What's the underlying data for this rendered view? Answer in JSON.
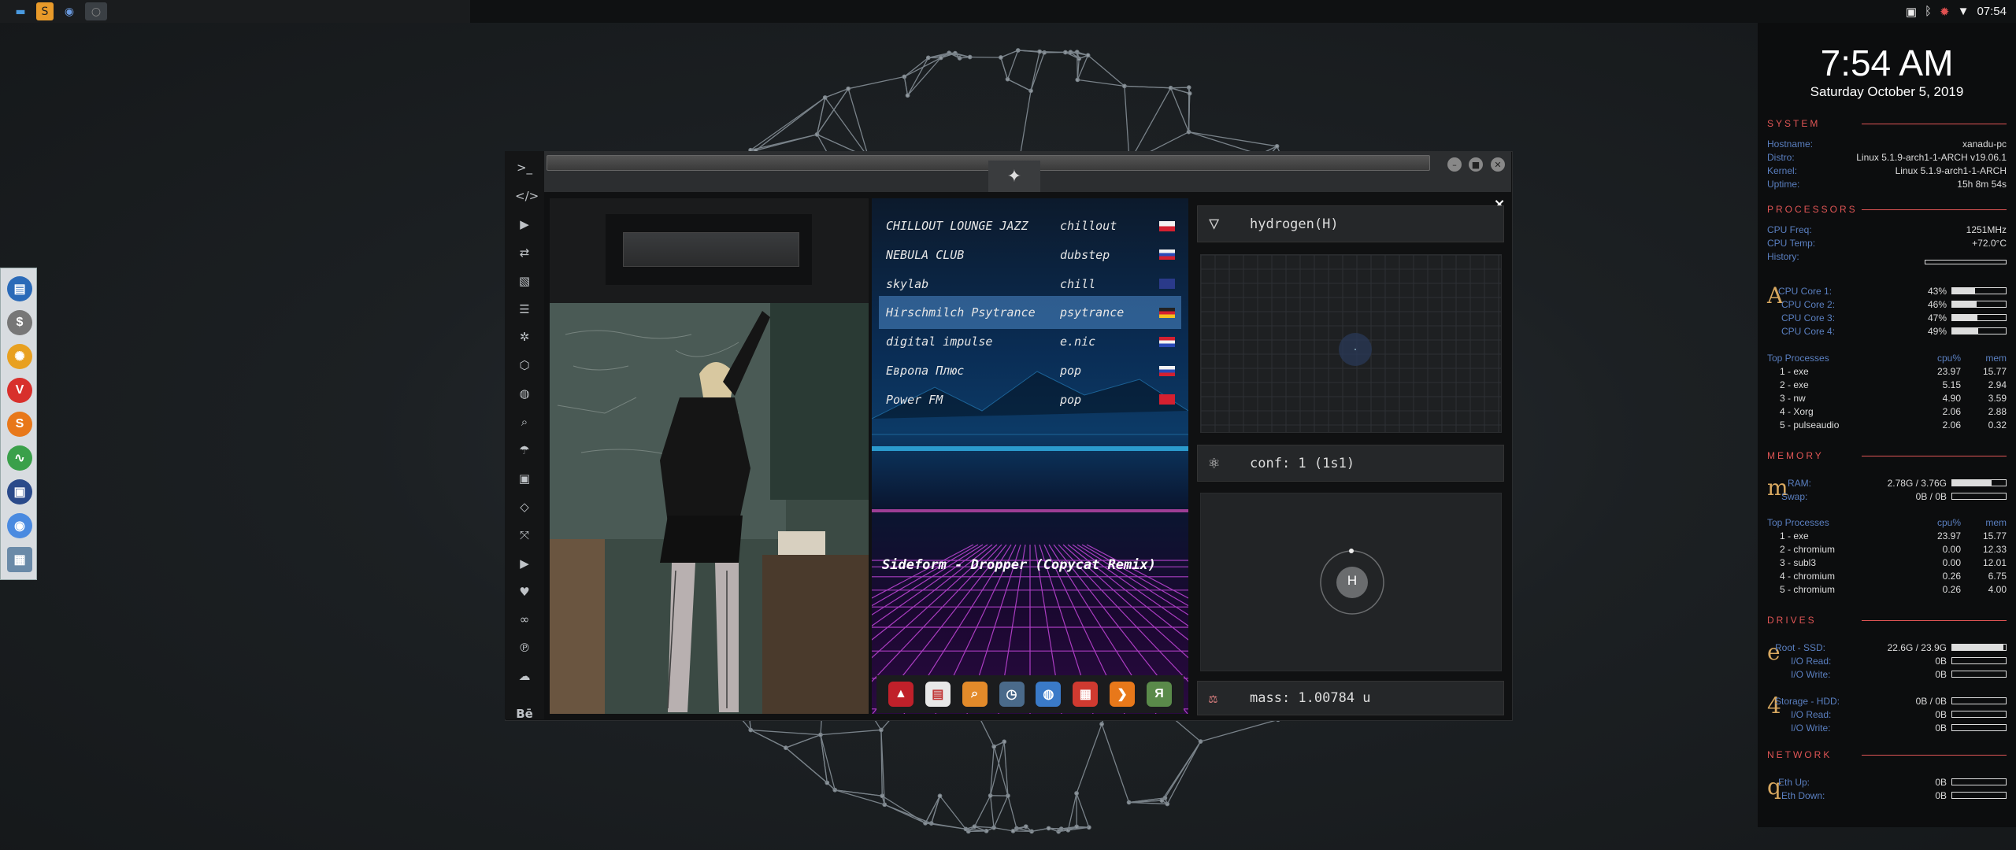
{
  "topbar": {
    "apps": [
      "files",
      "sublime",
      "chromium",
      "terminal"
    ],
    "time": "07:54"
  },
  "dock": {
    "items": [
      "files",
      "money",
      "settings",
      "vivaldi",
      "sublime",
      "activity",
      "screen",
      "chrome",
      "network"
    ]
  },
  "conky": {
    "clock": "7:54 AM",
    "date": "Saturday October  5, 2019",
    "system": {
      "title": "SYSTEM",
      "rows": [
        {
          "k": "Hostname:",
          "v": "xanadu-pc"
        },
        {
          "k": "Distro:",
          "v": "Linux 5.1.9-arch1-1-ARCH v19.06.1"
        },
        {
          "k": "Kernel:",
          "v": "Linux 5.1.9-arch1-1-ARCH"
        },
        {
          "k": "Uptime:",
          "v": "15h 8m 54s"
        }
      ]
    },
    "processors": {
      "title": "PROCESSORS",
      "rows": [
        {
          "k": "CPU Freq:",
          "v": "1251MHz"
        },
        {
          "k": "CPU Temp:",
          "v": "+72.0°C"
        },
        {
          "k": "History:",
          "v": ""
        }
      ],
      "letter": "A",
      "cores": [
        {
          "k": "CPU Core 1:",
          "v": "43%",
          "p": 43
        },
        {
          "k": "CPU Core 2:",
          "v": "46%",
          "p": 46
        },
        {
          "k": "CPU Core 3:",
          "v": "47%",
          "p": 47
        },
        {
          "k": "CPU Core 4:",
          "v": "49%",
          "p": 49
        }
      ],
      "top_title": "Top Processes",
      "col_cpu": "cpu%",
      "col_mem": "mem",
      "top": [
        {
          "name": "1 - exe",
          "cpu": "23.97",
          "mem": "15.77"
        },
        {
          "name": "2 - exe",
          "cpu": "5.15",
          "mem": "2.94"
        },
        {
          "name": "3 - nw",
          "cpu": "4.90",
          "mem": "3.59"
        },
        {
          "name": "4 - Xorg",
          "cpu": "2.06",
          "mem": "2.88"
        },
        {
          "name": "5 - pulseaudio",
          "cpu": "2.06",
          "mem": "0.32"
        }
      ]
    },
    "memory": {
      "title": "MEMORY",
      "letter": "m",
      "rows": [
        {
          "k": "RAM:",
          "v": "2.78G / 3.76G",
          "p": 74
        },
        {
          "k": "Swap:",
          "v": "0B / 0B",
          "p": 0
        }
      ],
      "top_title": "Top Processes",
      "col_cpu": "cpu%",
      "col_mem": "mem",
      "top": [
        {
          "name": "1 - exe",
          "cpu": "23.97",
          "mem": "15.77"
        },
        {
          "name": "2 - chromium",
          "cpu": "0.00",
          "mem": "12.33"
        },
        {
          "name": "3 - subl3",
          "cpu": "0.00",
          "mem": "12.01"
        },
        {
          "name": "4 - chromium",
          "cpu": "0.26",
          "mem": "6.75"
        },
        {
          "name": "5 - chromium",
          "cpu": "0.26",
          "mem": "4.00"
        }
      ]
    },
    "drives": {
      "title": "DRIVES",
      "root": {
        "letter": "e",
        "rows": [
          {
            "k": "Root  -  SSD:",
            "v": "22.6G / 23.9G",
            "p": 95
          },
          {
            "k": "I/O Read:",
            "v": "0B",
            "p": 0
          },
          {
            "k": "I/O Write:",
            "v": "0B",
            "p": 0
          }
        ]
      },
      "storage": {
        "letter": "4",
        "rows": [
          {
            "k": "Storage  -  HDD:",
            "v": "0B / 0B",
            "p": 0
          },
          {
            "k": "I/O Read:",
            "v": "0B",
            "p": 0
          },
          {
            "k": "I/O Write:",
            "v": "0B",
            "p": 0
          }
        ]
      }
    },
    "network": {
      "title": "NETWORK",
      "letter": "q",
      "rows": [
        {
          "k": "Eth Up:",
          "v": "0B",
          "p": 0
        },
        {
          "k": "Eth Down:",
          "v": "0B",
          "p": 0
        }
      ]
    }
  },
  "window": {
    "sidebar_icons": [
      "terminal-icon",
      "code-icon",
      "play-icon",
      "translate-icon",
      "image-icon",
      "news-icon",
      "settings-icon",
      "hexagon-icon",
      "globe-icon",
      "search-icon",
      "umbrella-icon",
      "contact-icon",
      "tag-icon",
      "expand-icon",
      "youtube-icon",
      "heart-icon",
      "infinity-icon",
      "pinterest-icon",
      "cloud-icon",
      "behance-icon"
    ],
    "behance_label": "Bē",
    "radio": {
      "stations": [
        {
          "name": "CHILLOUT LOUNGE JAZZ",
          "genre": "chillout",
          "flag": "pl"
        },
        {
          "name": "NEBULA CLUB",
          "genre": "dubstep",
          "flag": "ru"
        },
        {
          "name": "skylab",
          "genre": "chill",
          "flag": "gb"
        },
        {
          "name": "Hirschmilch Psytrance",
          "genre": "psytrance",
          "flag": "de",
          "selected": true
        },
        {
          "name": "digital impulse",
          "genre": "e.nic",
          "flag": "hr"
        },
        {
          "name": "Европа Плюс",
          "genre": "pop",
          "flag": "ru"
        },
        {
          "name": "Power FM",
          "genre": "pop",
          "flag": "tr"
        }
      ],
      "now_playing": "Sideform - Dropper (Copycat Remix)"
    },
    "launcher": [
      {
        "name": "arrow",
        "color": "#c0202a",
        "glyph": "▲"
      },
      {
        "name": "calendar-note",
        "color": "#e8e8e8",
        "glyph": "▤"
      },
      {
        "name": "search",
        "color": "#e38a2a",
        "glyph": "⌕"
      },
      {
        "name": "clock",
        "color": "#4a6a8a",
        "glyph": "◷"
      },
      {
        "name": "globe",
        "color": "#3a7ac8",
        "glyph": "◍"
      },
      {
        "name": "calendar",
        "color": "#d03a30",
        "glyph": "▦"
      },
      {
        "name": "forward",
        "color": "#e8781a",
        "glyph": "❯"
      },
      {
        "name": "yandex",
        "color": "#5a8a4a",
        "glyph": "Я"
      }
    ],
    "element": {
      "name": "hydrogen(H)",
      "config": "conf: 1 (1s1)",
      "symbol": "H",
      "mass": "mass: 1.00784 u"
    },
    "close_label": "×"
  },
  "colors": {
    "accent": "#e05555",
    "label_blue": "#5a7fc0",
    "letter_gold": "#d8a860"
  }
}
